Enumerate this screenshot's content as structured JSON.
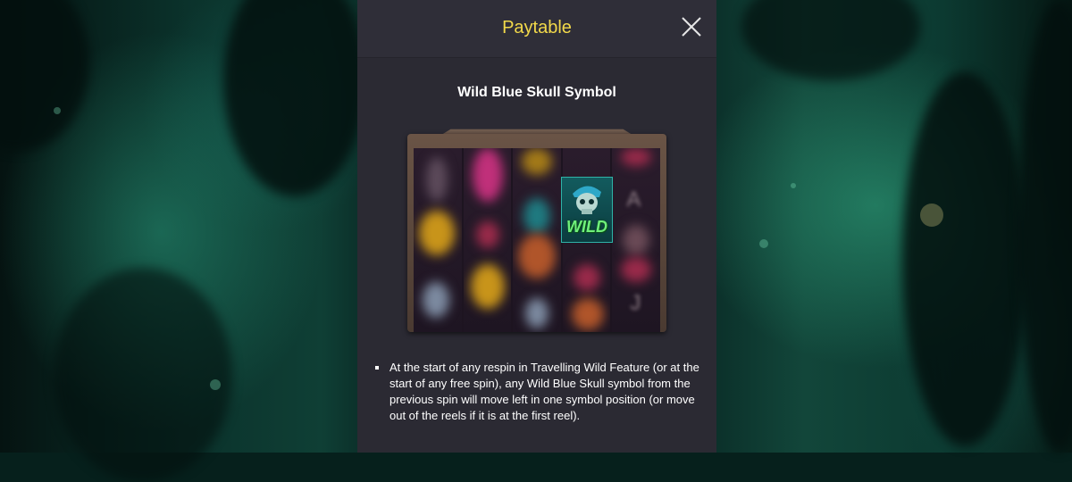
{
  "panel": {
    "title": "Paytable",
    "close_icon": "close-icon"
  },
  "section": {
    "title": "Wild Blue Skull Symbol",
    "wild_label": "WILD",
    "reel_letters": [
      "A",
      "J"
    ],
    "description": "At the start of any respin in Travelling Wild Feature (or at the start of any free spin), any Wild Blue Skull symbol from the previous spin will move left in one symbol position (or move out of the reels if it is at the first reel)."
  },
  "colors": {
    "title": "#f2d94a",
    "panel_bg": "#2b2a33",
    "text": "#ffffff",
    "wild_text": "#6ff07a"
  }
}
